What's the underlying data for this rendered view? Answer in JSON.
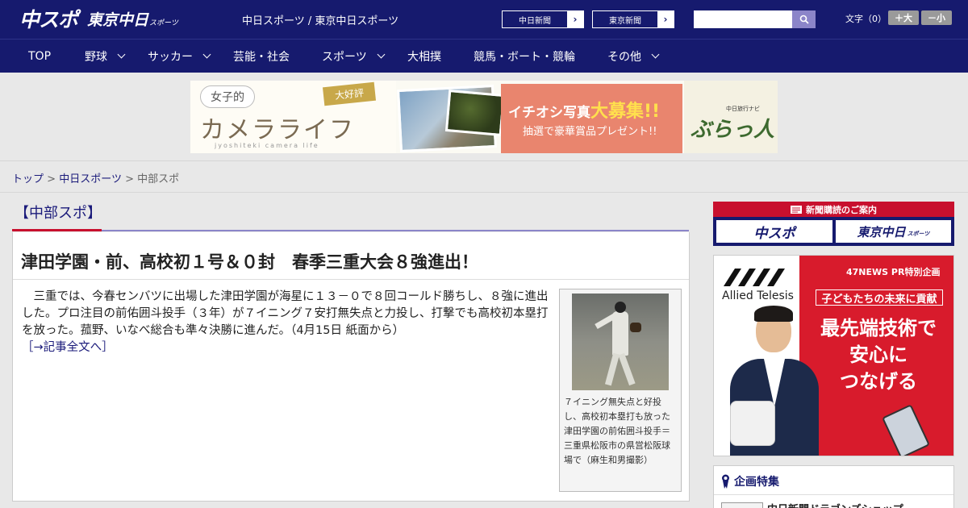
{
  "header": {
    "logo_chu": "中スポ",
    "logo_tokyo": "東京中日",
    "logo_sub": "スポーツ",
    "site_names": "中日スポーツ / 東京中日スポーツ",
    "ext_links": [
      {
        "label": "中日新聞",
        "arrow": "›"
      },
      {
        "label": "東京新聞",
        "arrow": "›"
      }
    ],
    "search": {
      "value": "",
      "placeholder": ""
    },
    "font_size_label": "文字（0）",
    "font_plus": "＋大",
    "font_minus": "－小"
  },
  "nav": {
    "items": [
      {
        "label": "TOP",
        "has_dropdown": false
      },
      {
        "label": "野球",
        "has_dropdown": true
      },
      {
        "label": "サッカー",
        "has_dropdown": true
      },
      {
        "label": "芸能・社会",
        "has_dropdown": false
      },
      {
        "label": "スポーツ",
        "has_dropdown": true
      },
      {
        "label": "大相撲",
        "has_dropdown": false
      },
      {
        "label": "競馬・ボート・競輪",
        "has_dropdown": false
      },
      {
        "label": "その他",
        "has_dropdown": true
      }
    ]
  },
  "banner": {
    "joshi": "女子的",
    "daikohyo": "大好評",
    "camera_life": "カメラライフ",
    "romaji": "jyoshiteki camera life",
    "ichioshi": "イチオシ写真",
    "daiboshu": "大募集!!",
    "prize": "抽選で豪華賞品プレゼント!!",
    "navi": "中日旅行ナビ",
    "burattabi": "ぶらっ人"
  },
  "breadcrumb": {
    "top": "トップ",
    "site": "中日スポーツ",
    "current": "中部スポ",
    "sep": ">"
  },
  "section": {
    "title": "【中部スポ】"
  },
  "article": {
    "headline": "津田学園・前、高校初１号＆０封　春季三重大会８強進出！",
    "body": "　三重では、今春センバツに出場した津田学園が海星に１３－０で８回コールド勝ちし、８強に進出した。プロ注目の前佑囲斗投手（３年）が７イニング７安打無失点と力投し、打撃でも高校初本塁打を放った。菰野、いなべ総合も準々決勝に進んだ。（4月15日 紙面から）",
    "more_link": "［→記事全文へ］",
    "caption": "７イニング無失点と好投し、高校初本塁打も放った津田学園の前佑囲斗投手＝三重県松阪市の県営松阪球場で（麻生和男撮影）"
  },
  "sidebar": {
    "subscription_header": "新聞購読のご案内",
    "sub_btn1": "中スポ",
    "sub_btn2": "東京中日",
    "sub_btn2_small": "スポーツ",
    "ad": {
      "company": "Allied Telesis",
      "label_47": "47NEWS PR特別企画",
      "kodomo": "子どもたちの未来に貢献",
      "headline_lines": [
        "最先端技術で",
        "安心に",
        "つなげる"
      ]
    },
    "feature_title": "企画特集",
    "feature_item": "中日新聞ドラゴンズショップ"
  },
  "colors": {
    "header_bg": "#161a6e",
    "accent_red": "#c8102e",
    "accent_purple": "#8b85c9",
    "link": "#1a1a7a"
  }
}
